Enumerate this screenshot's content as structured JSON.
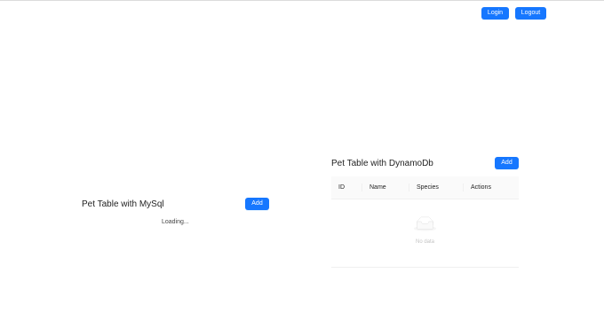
{
  "header": {
    "login_label": "Login",
    "logout_label": "Logout"
  },
  "mysql": {
    "title": "Pet Table with MySql",
    "add_label": "Add",
    "loading_text": "Loading..."
  },
  "dynamo": {
    "title": "Pet Table with DynamoDb",
    "add_label": "Add",
    "columns": [
      "ID",
      "Name",
      "Species",
      "Actions"
    ],
    "rows": [],
    "empty_text": "No data",
    "empty_icon": "empty-inbox-icon"
  },
  "colors": {
    "primary": "#1677ff",
    "header_bg": "#fafafa",
    "border": "#f0f0f0"
  }
}
